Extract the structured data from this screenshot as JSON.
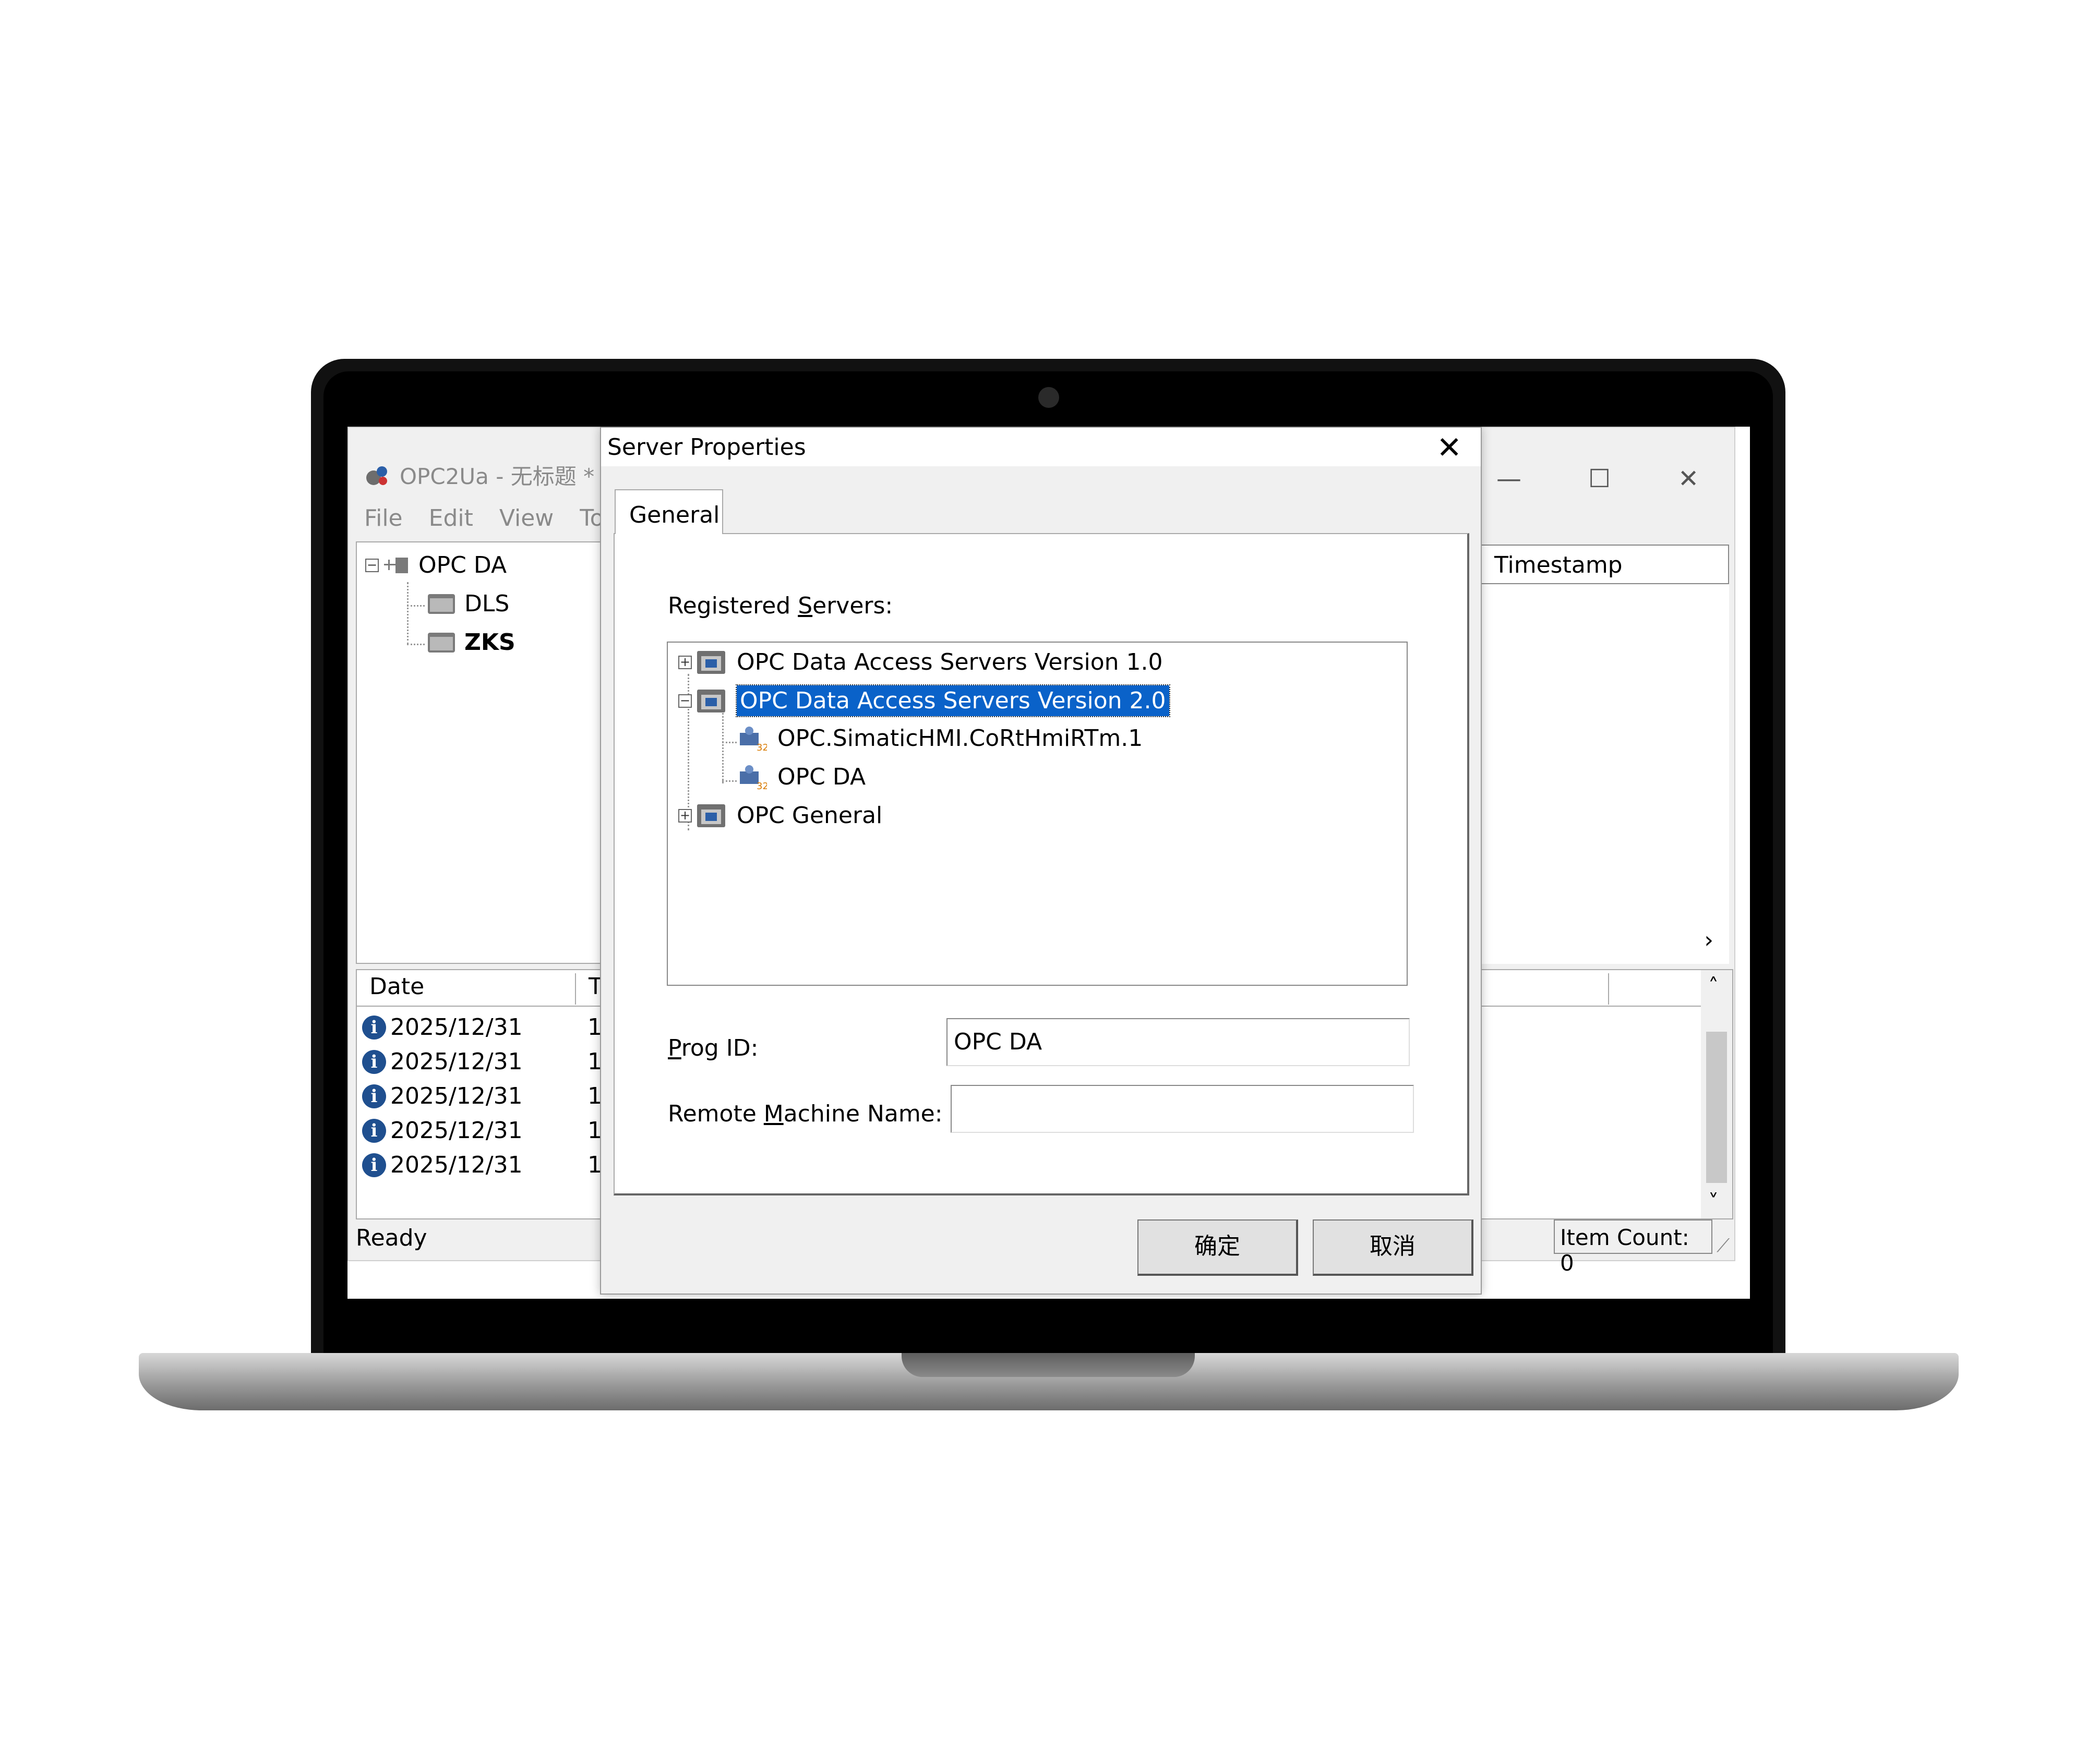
{
  "app": {
    "title": "OPC2Ua - 无标题 *",
    "menu": [
      "File",
      "Edit",
      "View",
      "To"
    ],
    "tree": {
      "root": "OPC DA",
      "children": [
        "DLS",
        "ZKS"
      ]
    },
    "right_header": "Timestamp",
    "log_columns": [
      "Date",
      "T"
    ],
    "log_rows": [
      {
        "date": "2025/12/31",
        "t": "1"
      },
      {
        "date": "2025/12/31",
        "t": "1"
      },
      {
        "date": "2025/12/31",
        "t": "1"
      },
      {
        "date": "2025/12/31",
        "t": "1"
      },
      {
        "date": "2025/12/31",
        "t": "1"
      }
    ],
    "status": "Ready",
    "item_count": "Item Count: 0",
    "controls": {
      "minimize": "—",
      "maximize": "☐",
      "close": "✕"
    }
  },
  "dialog": {
    "title": "Server Properties",
    "close": "✕",
    "tab": "General",
    "registered_servers_label": {
      "pre": "Registered ",
      "u": "S",
      "post": "ervers:"
    },
    "servers": [
      {
        "label": "OPC Data Access Servers Version 1.0",
        "expander": "+"
      },
      {
        "label": "OPC Data Access Servers Version 2.0",
        "expander": "−",
        "selected": true
      },
      {
        "label": "OPC.SimaticHMI.CoRtHmiRTm.1",
        "child": true
      },
      {
        "label": "OPC DA",
        "child": true
      },
      {
        "label": "OPC General",
        "expander": "+"
      }
    ],
    "prog_id_label": {
      "u": "P",
      "post": "rog ID:"
    },
    "prog_id_value": "OPC DA",
    "remote_label": {
      "pre": "Remote ",
      "u": "M",
      "post": "achine Name:"
    },
    "remote_value": "",
    "ok": "确定",
    "cancel": "取消"
  },
  "colors": {
    "selection": "#0a62c9",
    "info_icon": "#1f4f8f"
  },
  "icons": [
    "app-icon",
    "folder-icon",
    "network-icon",
    "info-icon",
    "server-icon",
    "scroll-arrow-icon",
    "resize-grip-icon"
  ]
}
